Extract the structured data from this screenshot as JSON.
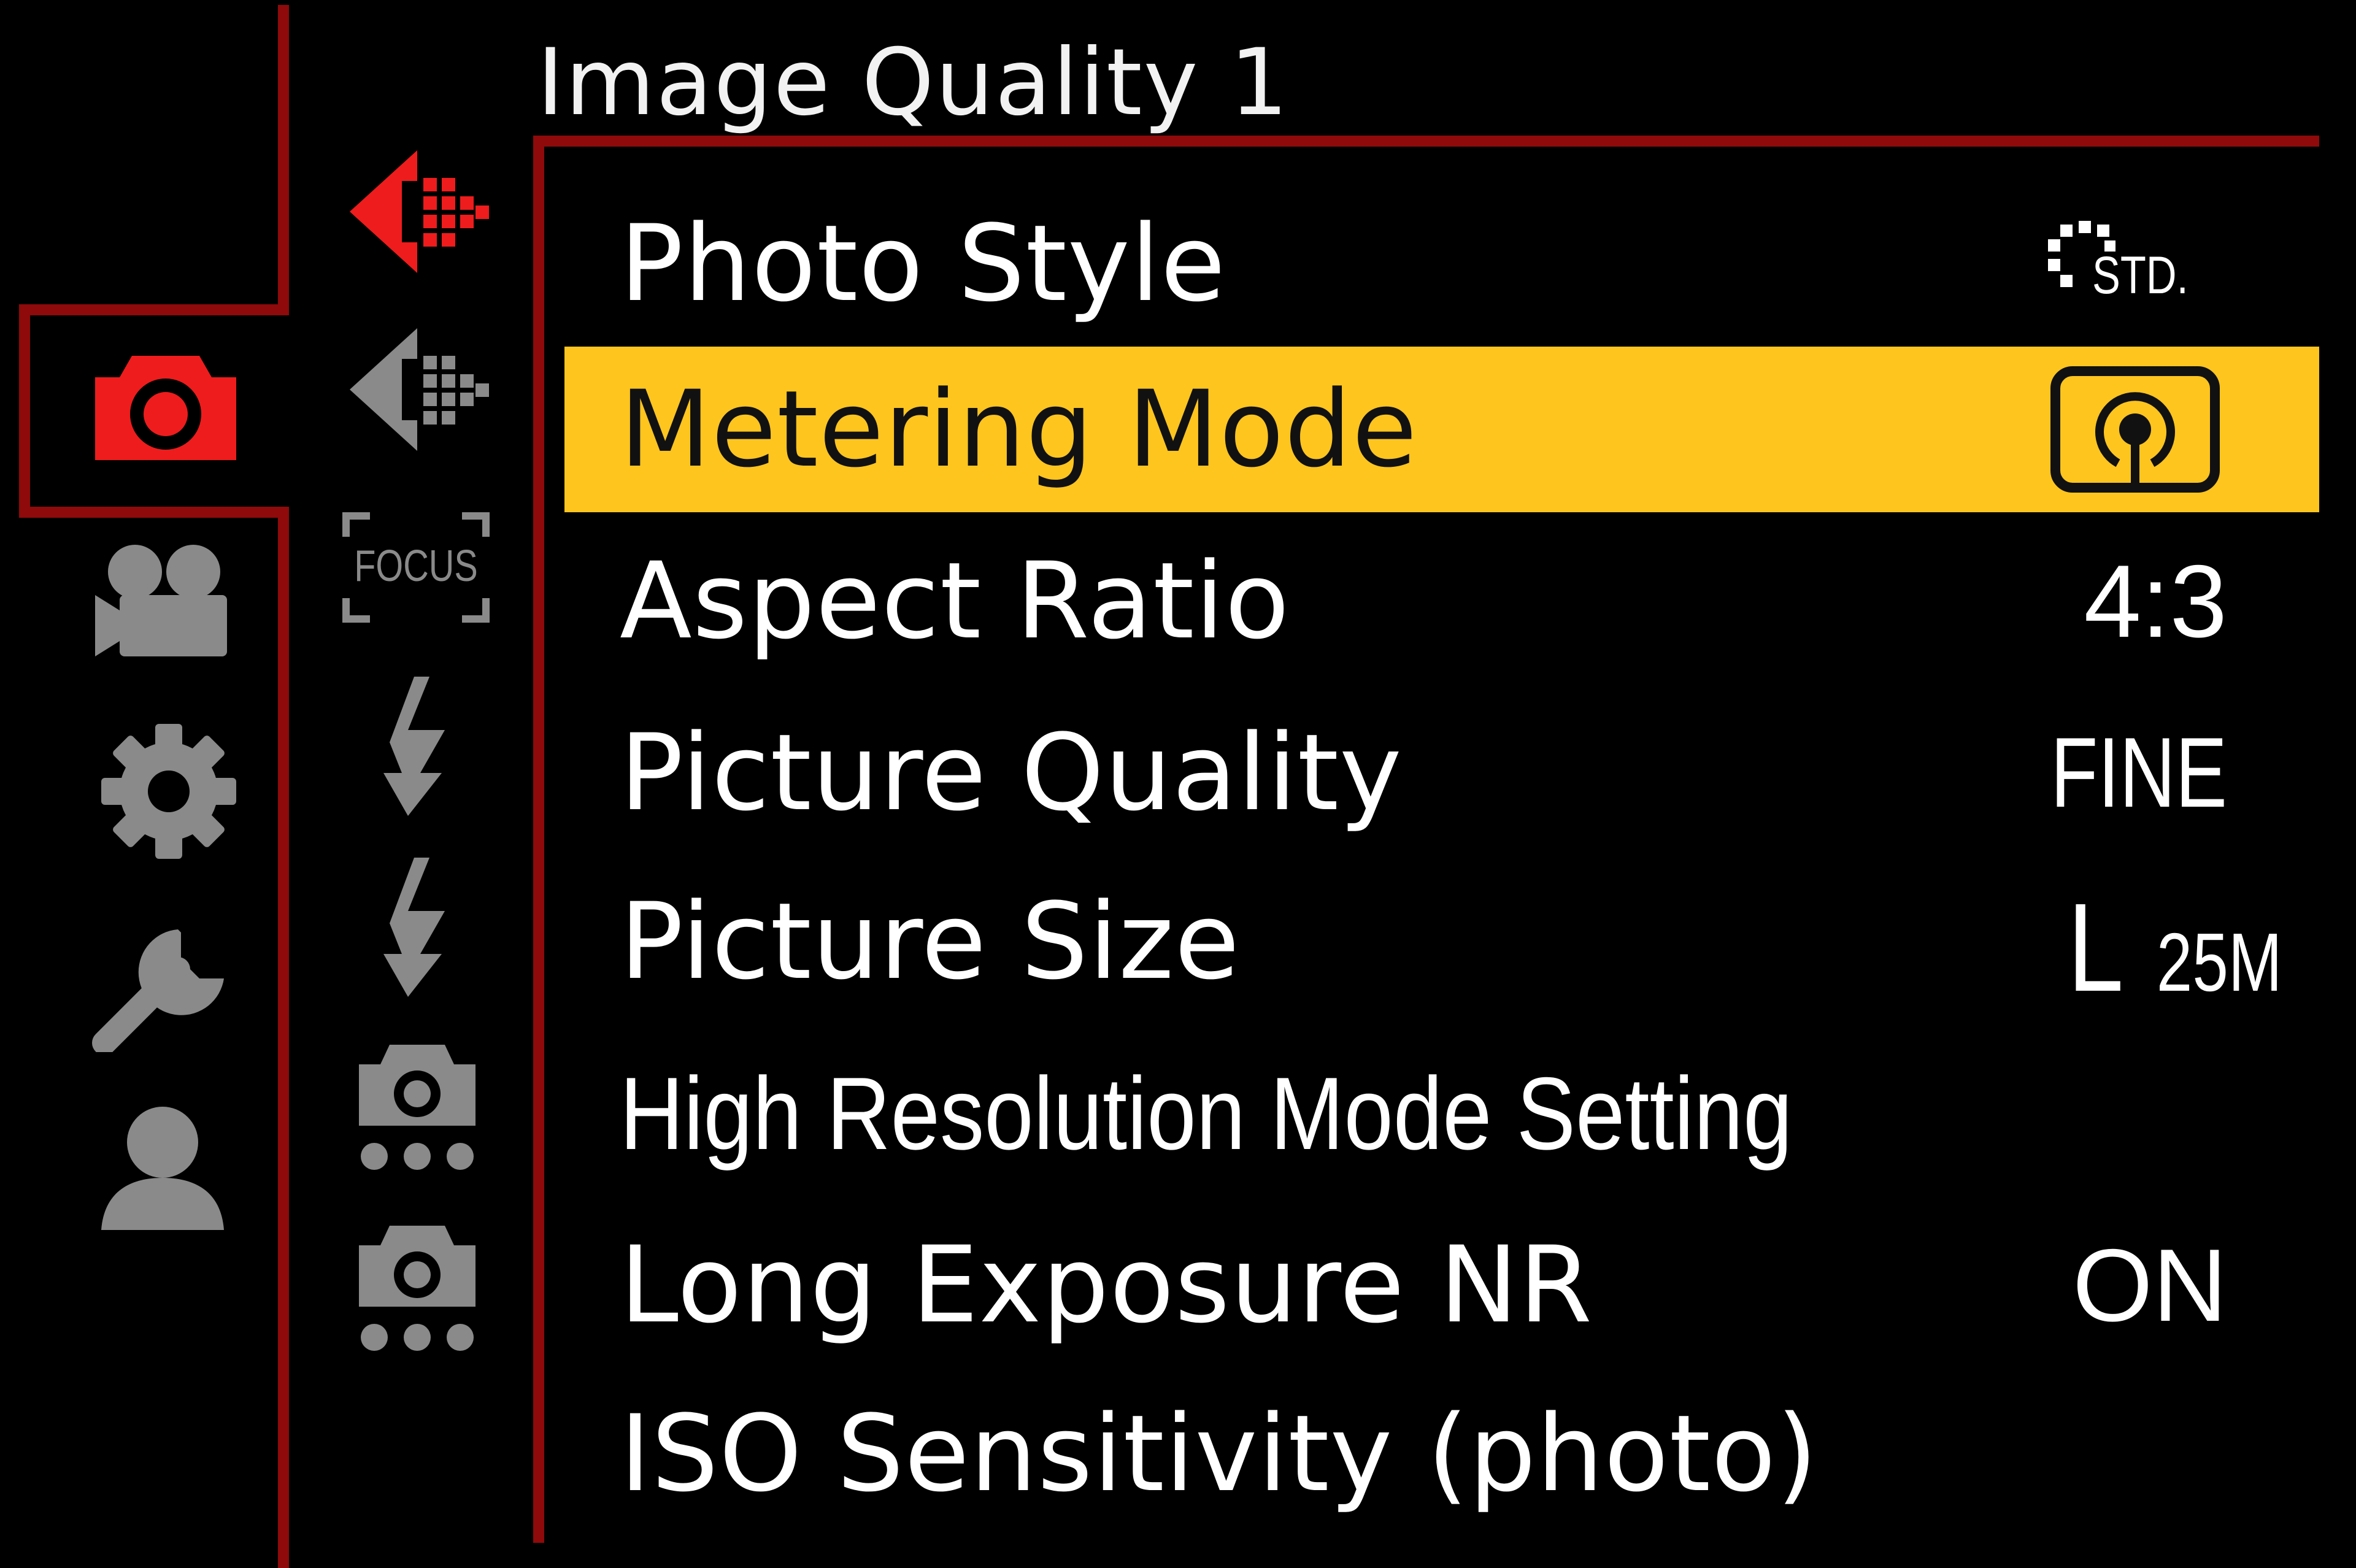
{
  "menu": {
    "title": "Image Quality 1"
  },
  "side_tabs": [
    {
      "name": "photo",
      "active": true
    },
    {
      "name": "video",
      "active": false
    },
    {
      "name": "custom",
      "active": false
    },
    {
      "name": "setup",
      "active": false
    },
    {
      "name": "my-menu",
      "active": false
    }
  ],
  "page_tabs": [
    {
      "name": "image-quality-1",
      "active": true
    },
    {
      "name": "image-quality-2",
      "active": false
    },
    {
      "name": "focus",
      "active": false,
      "text": "FOCUS"
    },
    {
      "name": "flash-1",
      "active": false
    },
    {
      "name": "flash-2",
      "active": false
    },
    {
      "name": "others-1",
      "active": false
    },
    {
      "name": "others-2",
      "active": false
    }
  ],
  "items": [
    {
      "label": "Photo Style",
      "value_text": "STD.",
      "value_icon": "photo-style-standard-icon",
      "selected": false
    },
    {
      "label": "Metering Mode",
      "value_text": "",
      "value_icon": "multiple-metering-icon",
      "selected": true
    },
    {
      "label": "Aspect Ratio",
      "value_text": "4:3",
      "value_icon": "",
      "selected": false
    },
    {
      "label": "Picture Quality",
      "value_text": "FINE",
      "value_icon": "",
      "selected": false
    },
    {
      "label": "Picture Size",
      "value_text": "L 25M",
      "value_icon": "picture-size-icon",
      "value_big": "L",
      "value_small": "25M",
      "selected": false
    },
    {
      "label": "High Resolution Mode Setting",
      "value_text": "",
      "value_icon": "",
      "selected": false
    },
    {
      "label": "Long Exposure NR",
      "value_text": "ON",
      "value_icon": "",
      "selected": false
    },
    {
      "label": "ISO Sensitivity (photo)",
      "value_text": "",
      "value_icon": "",
      "selected": false
    }
  ],
  "colors": {
    "background": "#000000",
    "frame_red": "#8f0a0a",
    "active_red": "#ee1c1c",
    "inactive_gray": "#8a8a8a",
    "selected_row": "#ffc51f",
    "text": "#ffffff"
  }
}
